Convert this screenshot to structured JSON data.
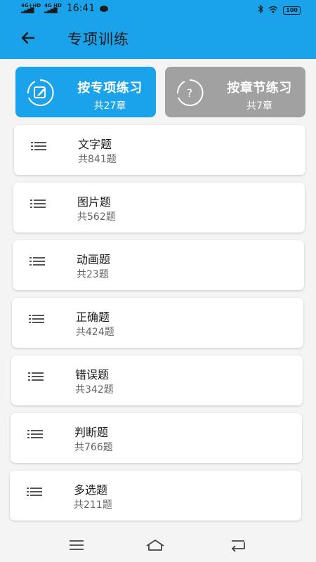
{
  "status_bar": {
    "network_1": "4G+HD",
    "network_2": "4G HD",
    "time": "16:41",
    "battery": "100"
  },
  "header": {
    "title": "专项训练",
    "back_icon": "arrow-left-icon"
  },
  "tabs": [
    {
      "title": "按专项练习",
      "sub": "共27章",
      "icon": "edit-circle-icon",
      "active": true
    },
    {
      "title": "按章节练习",
      "sub": "共7章",
      "icon": "question-circle-icon",
      "active": false
    }
  ],
  "items": [
    {
      "title": "文字题",
      "count": "共841题"
    },
    {
      "title": "图片题",
      "count": "共562题"
    },
    {
      "title": "动画题",
      "count": "共23题"
    },
    {
      "title": "正确题",
      "count": "共424题"
    },
    {
      "title": "错误题",
      "count": "共342题"
    },
    {
      "title": "判断题",
      "count": "共766题"
    },
    {
      "title": "多选题",
      "count": "共211题"
    }
  ],
  "nav": {
    "menu_icon": "menu-icon",
    "home_icon": "home-icon",
    "back_icon": "back-icon"
  },
  "colors": {
    "accent": "#1aa3ea",
    "inactive_tab": "#a1a1a1"
  }
}
